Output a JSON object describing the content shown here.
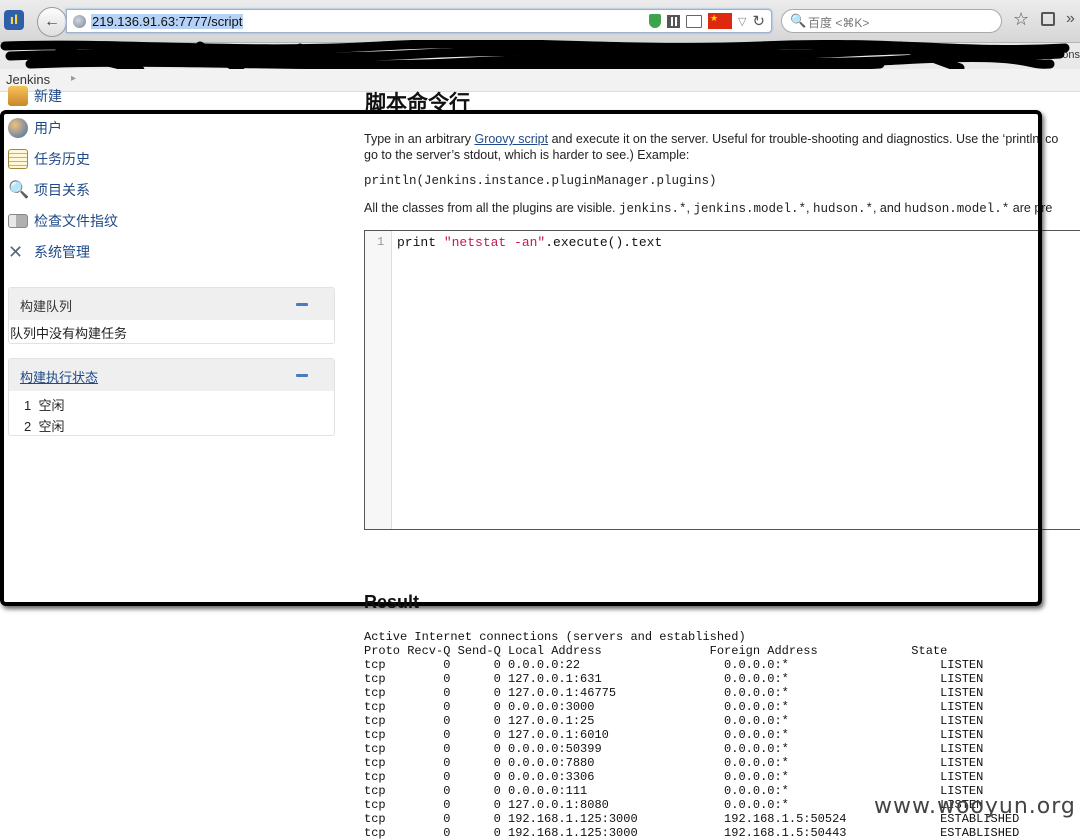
{
  "browser": {
    "url": "219.136.91.63:7777/script",
    "search_placeholder": "百度 <⌘K>",
    "bookmarks_tail": "ons"
  },
  "breadcrumb": {
    "home": "Jenkins"
  },
  "sidebar": {
    "tasks": [
      {
        "label": "新建",
        "icon": "new-item-icon"
      },
      {
        "label": "用户",
        "icon": "users-icon"
      },
      {
        "label": "任务历史",
        "icon": "build-history-icon"
      },
      {
        "label": "项目关系",
        "icon": "search-icon"
      },
      {
        "label": "检查文件指纹",
        "icon": "fingerprint-icon"
      },
      {
        "label": "系统管理",
        "icon": "tools-icon"
      }
    ],
    "build_queue": {
      "title": "构建队列",
      "empty_text": "队列中没有构建任务"
    },
    "executors": {
      "title": "构建执行状态",
      "items": [
        {
          "num": "1",
          "status": "空闲"
        },
        {
          "num": "2",
          "status": "空闲"
        }
      ]
    }
  },
  "main": {
    "title": "脚本命令行",
    "desc_before": "Type in an arbitrary ",
    "desc_link": "Groovy script",
    "desc_after": " and execute it on the server. Useful for trouble-shooting and diagnostics. Use the ‘println’ co",
    "desc_line2": "go to the server’s stdout, which is harder to see.) Example:",
    "example": "println(Jenkins.instance.pluginManager.plugins)",
    "classes_text": "All the classes from all the plugins are visible.",
    "classes_code1": "jenkins.*",
    "classes_code2": "jenkins.model.*",
    "classes_code3": "hudson.*",
    "classes_and": "and",
    "classes_code4": "hudson.model.*",
    "classes_end": "are pre",
    "editor": {
      "line_number": "1",
      "code_before": "print ",
      "code_string": "\"netstat -an\"",
      "code_after": ".execute().text"
    }
  },
  "result": {
    "title": "Result",
    "header": "Active Internet connections (servers and established)",
    "columns": [
      "Proto",
      "Recv-Q",
      "Send-Q",
      "Local Address",
      "Foreign Address",
      "State"
    ],
    "rows": [
      [
        "tcp",
        "0",
        "0",
        "0.0.0.0:22",
        "0.0.0.0:*",
        "LISTEN"
      ],
      [
        "tcp",
        "0",
        "0",
        "127.0.0.1:631",
        "0.0.0.0:*",
        "LISTEN"
      ],
      [
        "tcp",
        "0",
        "0",
        "127.0.0.1:46775",
        "0.0.0.0:*",
        "LISTEN"
      ],
      [
        "tcp",
        "0",
        "0",
        "0.0.0.0:3000",
        "0.0.0.0:*",
        "LISTEN"
      ],
      [
        "tcp",
        "0",
        "0",
        "127.0.0.1:25",
        "0.0.0.0:*",
        "LISTEN"
      ],
      [
        "tcp",
        "0",
        "0",
        "127.0.0.1:6010",
        "0.0.0.0:*",
        "LISTEN"
      ],
      [
        "tcp",
        "0",
        "0",
        "0.0.0.0:50399",
        "0.0.0.0:*",
        "LISTEN"
      ],
      [
        "tcp",
        "0",
        "0",
        "0.0.0.0:7880",
        "0.0.0.0:*",
        "LISTEN"
      ],
      [
        "tcp",
        "0",
        "0",
        "0.0.0.0:3306",
        "0.0.0.0:*",
        "LISTEN"
      ],
      [
        "tcp",
        "0",
        "0",
        "0.0.0.0:111",
        "0.0.0.0:*",
        "LISTEN"
      ],
      [
        "tcp",
        "0",
        "0",
        "127.0.0.1:8080",
        "0.0.0.0:*",
        "LISTEN"
      ],
      [
        "tcp",
        "0",
        "0",
        "192.168.1.125:3000",
        "192.168.1.5:50524",
        "ESTABLISHED"
      ],
      [
        "tcp",
        "0",
        "0",
        "192.168.1.125:3000",
        "192.168.1.5:50443",
        "ESTABLISHED"
      ]
    ]
  },
  "watermark": "www.wooyun.org"
}
